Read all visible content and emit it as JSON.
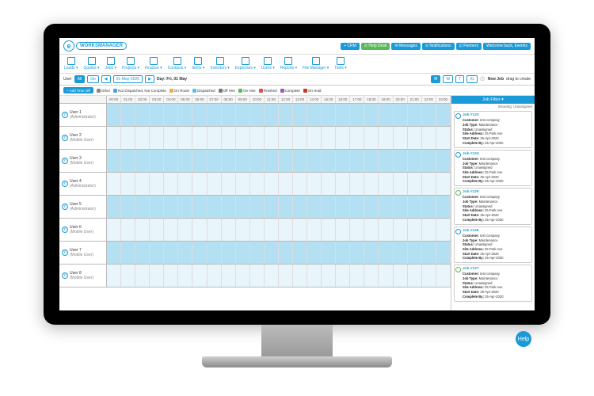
{
  "brand": {
    "logo_letter": "e",
    "logo_text": "WORKSMANAGER"
  },
  "header_pills": {
    "crm": "+ CRM",
    "help": "⊙ Help Desk",
    "messages": "✉ Messages",
    "notifications": "⊙ Notifications",
    "partners": "⊡ Partners",
    "welcome": "Welcome back, Eworks"
  },
  "menu": [
    "Leads",
    "Quotes",
    "Jobs",
    "Projects",
    "Finance",
    "Contacts",
    "Items",
    "Inventory",
    "Expenses",
    "Users",
    "Reports",
    "File Manager",
    "Tools"
  ],
  "toolbar": {
    "user_label": "User",
    "user_all": "All",
    "go": "Go",
    "date": "01-May-2020",
    "day": "Day: Fri, 01 May",
    "viewM": "M",
    "viewW": "W",
    "viewT": "T",
    "newjob_label": "New Job",
    "newjob_hint": "drag to create"
  },
  "legend": {
    "addtimeoff": "+ Add Time Off",
    "items": [
      {
        "label": "Other",
        "color": "#888"
      },
      {
        "label": "Not Dispatched, Not Complete",
        "color": "#4aa3df"
      },
      {
        "label": "On Route",
        "color": "#f0ad4e"
      },
      {
        "label": "Dispatched",
        "color": "#5bc0de"
      },
      {
        "label": "Off Hire",
        "color": "#777"
      },
      {
        "label": "On Hire",
        "color": "#5cb85c"
      },
      {
        "label": "Finished",
        "color": "#d9534f"
      },
      {
        "label": "Complete",
        "color": "#9b59b6"
      },
      {
        "label": "On Hold",
        "color": "#c0392b"
      }
    ]
  },
  "hours": [
    "00:00",
    "01:00",
    "02:00",
    "03:00",
    "04:00",
    "05:00",
    "06:00",
    "07:00",
    "08:00",
    "09:00",
    "10:00",
    "11:00",
    "12:00",
    "13:00",
    "14:00",
    "15:00",
    "16:00",
    "17:00",
    "18:00",
    "19:00",
    "20:00",
    "21:00",
    "22:00",
    "23:00"
  ],
  "users": [
    {
      "name": "User 1",
      "role": "(Administrator)"
    },
    {
      "name": "User 2",
      "role": "(Mobile User)"
    },
    {
      "name": "User 3",
      "role": "(Mobile User)"
    },
    {
      "name": "User 4",
      "role": "(Administrator)"
    },
    {
      "name": "User 5",
      "role": "(Administrator)"
    },
    {
      "name": "User 6",
      "role": "(Mobile User)"
    },
    {
      "name": "User 7",
      "role": "(Mobile User)"
    },
    {
      "name": "User 8",
      "role": "(Mobile User)"
    }
  ],
  "sidepanel": {
    "filter_title": "Job Filter ▾",
    "showing": "Showing: Unassigned",
    "cards": [
      {
        "jobno": "Job #123",
        "customer": "test company",
        "jobtype": "Maintenance",
        "status": "Unassigned",
        "siteaddr": "25 Park Ave",
        "startdate": "25-Apr-2020",
        "completeby": "25-Apr-2020",
        "g": false
      },
      {
        "jobno": "Job #124",
        "customer": "test company",
        "jobtype": "Maintenance",
        "status": "Unassigned",
        "siteaddr": "25 Park Ave",
        "startdate": "25-Apr-2020",
        "completeby": "25-Apr-2020",
        "g": false
      },
      {
        "jobno": "Job #125",
        "customer": "test company",
        "jobtype": "Maintenance",
        "status": "Unassigned",
        "siteaddr": "25 Park Ave",
        "startdate": "25-Apr-2020",
        "completeby": "25-Apr-2020",
        "g": true
      },
      {
        "jobno": "Job #126",
        "customer": "test company",
        "jobtype": "Maintenance",
        "status": "Unassigned",
        "siteaddr": "25 Park Ave",
        "startdate": "25-Apr-2020",
        "completeby": "25-Apr-2020",
        "g": false
      },
      {
        "jobno": "Job #127",
        "customer": "test company",
        "jobtype": "Maintenance",
        "status": "Unassigned",
        "siteaddr": "25 Park Ave",
        "startdate": "25-Apr-2020",
        "completeby": "25-Apr-2020",
        "g": true
      }
    ],
    "labels": {
      "customer": "Customer:",
      "jobtype": "Job Type:",
      "status": "Status:",
      "siteaddr": "Site Address:",
      "startdate": "Start Date:",
      "completeby": "Complete By:"
    }
  },
  "help": "Help"
}
